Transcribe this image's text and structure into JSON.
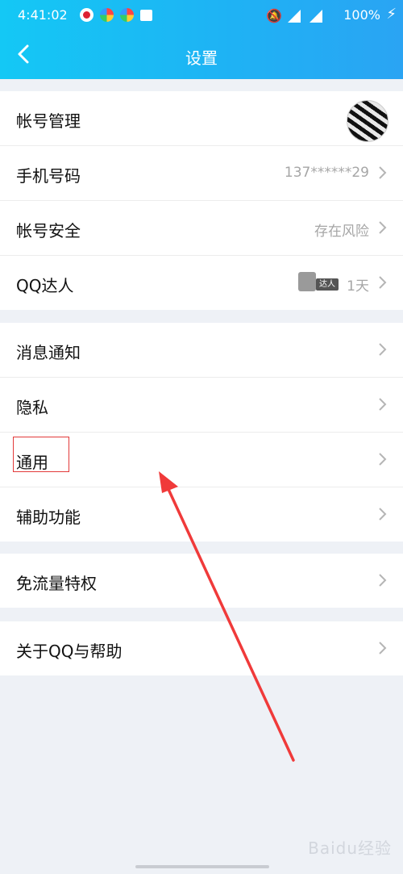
{
  "status_bar": {
    "time": "4:41:02",
    "battery": "100%",
    "network": "4G"
  },
  "header": {
    "title": "设置"
  },
  "groups": [
    {
      "items": [
        {
          "label": "帐号管理",
          "value": "",
          "accessory": "avatar"
        },
        {
          "label": "手机号码",
          "value": "137******29"
        },
        {
          "label": "帐号安全",
          "value": "存在风险"
        },
        {
          "label": "QQ达人",
          "value": "1天",
          "badge_text": "达人"
        }
      ]
    },
    {
      "items": [
        {
          "label": "消息通知",
          "value": ""
        },
        {
          "label": "隐私",
          "value": ""
        },
        {
          "label": "通用",
          "value": ""
        },
        {
          "label": "辅助功能",
          "value": ""
        }
      ]
    },
    {
      "items": [
        {
          "label": "免流量特权",
          "value": ""
        }
      ]
    },
    {
      "items": [
        {
          "label": "关于QQ与帮助",
          "value": ""
        }
      ]
    }
  ],
  "watermark": "Baidu经验",
  "colors": {
    "header_start": "#14c8f5",
    "header_end": "#2aa4f3",
    "annotation": "#e23a3a"
  }
}
